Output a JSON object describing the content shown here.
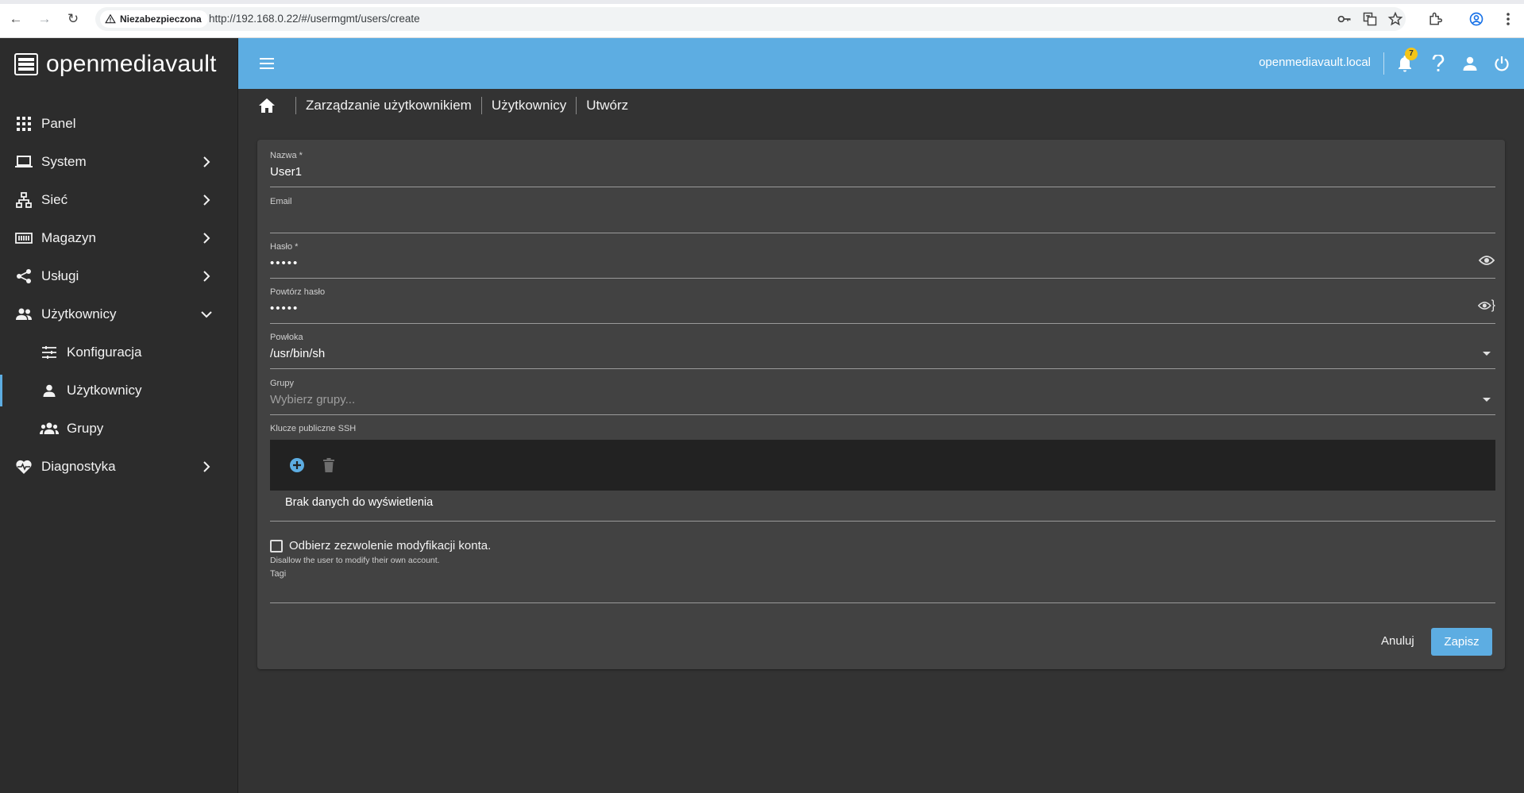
{
  "browser": {
    "security_label": "Niezabezpieczona",
    "url": "http://192.168.0.22/#/usermgmt/users/create"
  },
  "brand": {
    "name": "openmediavault"
  },
  "sidebar": {
    "items": [
      {
        "label": "Panel",
        "icon": "grid-icon"
      },
      {
        "label": "System",
        "icon": "laptop-icon"
      },
      {
        "label": "Sieć",
        "icon": "network-icon"
      },
      {
        "label": "Magazyn",
        "icon": "storage-icon"
      },
      {
        "label": "Usługi",
        "icon": "share-icon"
      },
      {
        "label": "Użytkownicy",
        "icon": "users-icon"
      },
      {
        "label": "Konfiguracja",
        "icon": "tune-icon"
      },
      {
        "label": "Użytkownicy",
        "icon": "user-icon"
      },
      {
        "label": "Grupy",
        "icon": "groups-icon"
      },
      {
        "label": "Diagnostyka",
        "icon": "heart-pulse-icon"
      }
    ]
  },
  "appbar": {
    "hostname": "openmediavault.local",
    "notification_count": "7"
  },
  "breadcrumb": [
    "Zarządzanie użytkownikiem",
    "Użytkownicy",
    "Utwórz"
  ],
  "form": {
    "name": {
      "label": "Nazwa *",
      "value": "User1"
    },
    "email": {
      "label": "Email",
      "value": ""
    },
    "password": {
      "label": "Hasło *",
      "value": "•••••"
    },
    "password_repeat": {
      "label": "Powtórz hasło",
      "value": "•••••"
    },
    "shell": {
      "label": "Powłoka",
      "value": "/usr/bin/sh"
    },
    "groups": {
      "label": "Grupy",
      "placeholder": "Wybierz grupy..."
    },
    "ssh_keys": {
      "label": "Klucze publiczne SSH",
      "empty_text": "Brak danych do wyświetlenia"
    },
    "disallow": {
      "label": "Odbierz zezwolenie modyfikacji konta.",
      "hint": "Disallow the user to modify their own account.",
      "checked": false
    },
    "tags": {
      "label": "Tagi",
      "value": ""
    }
  },
  "actions": {
    "cancel": "Anuluj",
    "save": "Zapisz"
  },
  "colors": {
    "accent": "#5dade2",
    "sidebar": "#2c2c2c",
    "content": "#333333",
    "card": "#424242"
  }
}
